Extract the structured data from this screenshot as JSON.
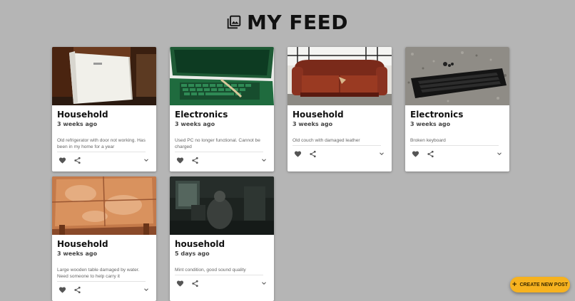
{
  "header": {
    "title": "MY FEED",
    "icon": "photo-library-icon"
  },
  "posts": [
    {
      "category": "Household",
      "time": "3 weeks ago",
      "description": "Old refrigerator with door not working. Has been in my home for a year",
      "image": "refrigerator"
    },
    {
      "category": "Electronics",
      "time": "3 weeks ago",
      "description": "Used PC no longer functional. Cannot be charged",
      "image": "laptop"
    },
    {
      "category": "Household",
      "time": "3 weeks ago",
      "description": "Old couch with damaged leather",
      "image": "couch"
    },
    {
      "category": "Electronics",
      "time": "3 weeks ago",
      "description": "Broken keyboard",
      "image": "keyboard"
    },
    {
      "category": "Household",
      "time": "3 weeks ago",
      "description": "Large wooden table damaged by water. Need someone to help carry it",
      "image": "table"
    },
    {
      "category": "household",
      "time": "5 days ago",
      "description": "Mint condition, good sound quality",
      "image": "dark-room"
    }
  ],
  "fab": {
    "label": "CREATE NEW POST",
    "icon": "plus-icon",
    "color": "#f6b21f"
  },
  "colors": {
    "background": "#b5b5b5",
    "card": "#ffffff",
    "icon": "#555555"
  }
}
